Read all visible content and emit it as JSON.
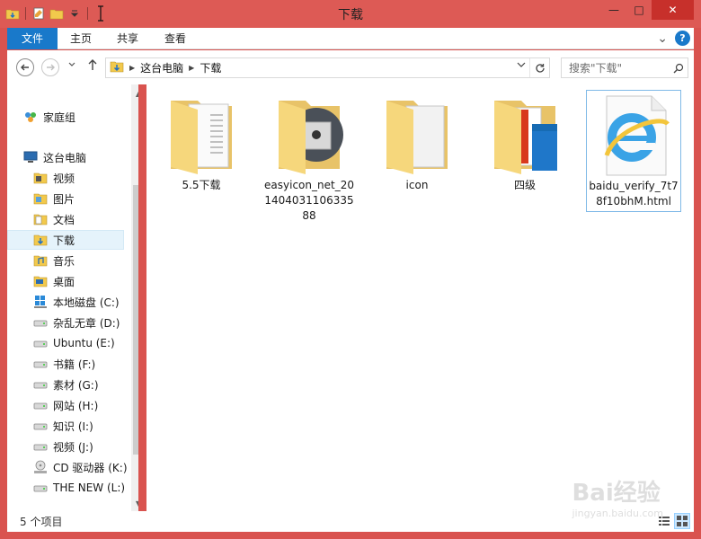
{
  "window": {
    "title": "下载",
    "minimize": "—",
    "maximize": "□",
    "close": "✕"
  },
  "ribbon": {
    "tabs": [
      {
        "label": "文件"
      },
      {
        "label": "主页"
      },
      {
        "label": "共享"
      },
      {
        "label": "查看"
      }
    ],
    "collapse": "⌄",
    "help": "?"
  },
  "address": {
    "crumbs": [
      "这台电脑",
      "下载"
    ],
    "search_placeholder": "搜索\"下载\""
  },
  "nav": {
    "items": [
      {
        "label": "家庭组",
        "icon": "homegroup-icon"
      },
      {
        "label": "这台电脑",
        "icon": "computer-icon"
      },
      {
        "label": "视频",
        "icon": "videos-folder-icon"
      },
      {
        "label": "图片",
        "icon": "pictures-folder-icon"
      },
      {
        "label": "文档",
        "icon": "documents-folder-icon"
      },
      {
        "label": "下载",
        "icon": "downloads-folder-icon"
      },
      {
        "label": "音乐",
        "icon": "music-folder-icon"
      },
      {
        "label": "桌面",
        "icon": "desktop-folder-icon"
      },
      {
        "label": "本地磁盘 (C:)",
        "icon": "windows-drive-icon"
      },
      {
        "label": "杂乱无章 (D:)",
        "icon": "drive-icon"
      },
      {
        "label": "Ubuntu (E:)",
        "icon": "drive-icon"
      },
      {
        "label": "书籍 (F:)",
        "icon": "drive-icon"
      },
      {
        "label": "素材 (G:)",
        "icon": "drive-icon"
      },
      {
        "label": "网站 (H:)",
        "icon": "drive-icon"
      },
      {
        "label": "知识 (I:)",
        "icon": "drive-icon"
      },
      {
        "label": "视频 (J:)",
        "icon": "drive-icon"
      },
      {
        "label": "CD 驱动器 (K:)",
        "icon": "cd-drive-icon"
      },
      {
        "label": "THE NEW (L:)",
        "icon": "drive-icon"
      }
    ],
    "selected_index": 5
  },
  "files": [
    {
      "label": "5.5下载",
      "icon": "folder-document-icon"
    },
    {
      "label": "easyicon_net_201404031106335 88",
      "icon": "folder-disc-icon"
    },
    {
      "label": "icon",
      "icon": "folder-blank-icon"
    },
    {
      "label": "四级",
      "icon": "folder-book-icon"
    },
    {
      "label": "baidu_verify_7t78f10bhM.html",
      "icon": "internet-explorer-file-icon"
    }
  ],
  "status": {
    "item_count": "5 个项目"
  },
  "watermark": {
    "brand": "Bai经验",
    "url": "jingyan.baidu.com"
  }
}
